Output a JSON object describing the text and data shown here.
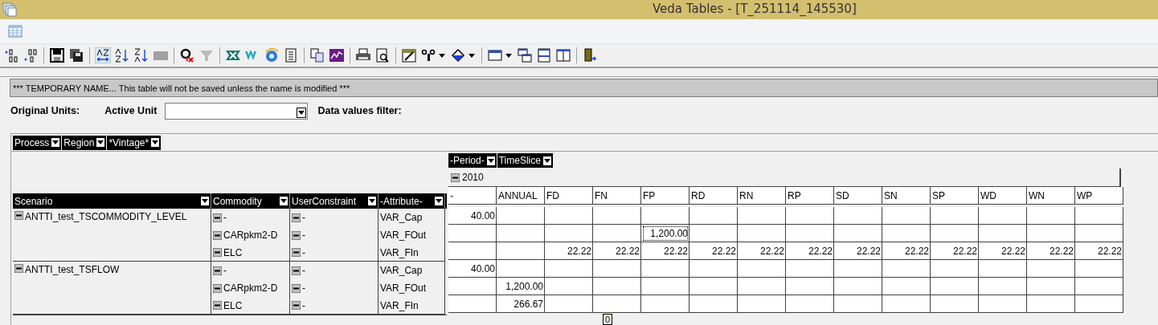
{
  "window": {
    "title": "Veda Tables - [T_251114_145530]"
  },
  "banner": "*** TEMPORARY NAME... This table will not be saved unless the name is modified ***",
  "filters": {
    "original_units": "Original Units:",
    "active_unit": "Active Unit",
    "data_values_filter": "Data values filter:"
  },
  "page_fields": [
    "Process",
    "Region",
    "*Vintage*"
  ],
  "column_fields": [
    "-Period-",
    "TimeSlice"
  ],
  "period": "2010",
  "row_headers": [
    "Scenario",
    "Commodity",
    "UserConstraint",
    "-Attribute-"
  ],
  "columns": [
    "-",
    "ANNUAL",
    "FD",
    "FN",
    "FP",
    "RD",
    "RN",
    "RP",
    "SD",
    "SN",
    "SP",
    "WD",
    "WN",
    "WP"
  ],
  "groups": [
    {
      "scenario": "ANTTI_test_TSCOMMODITY_LEVEL",
      "rows": [
        {
          "commodity": "-",
          "user_constraint": "-",
          "attribute": "VAR_Cap",
          "cells": [
            {
              "value": "40.00",
              "selected": false
            },
            null,
            null,
            null,
            null,
            null,
            null,
            null,
            null,
            null,
            null,
            null,
            null,
            null
          ]
        },
        {
          "commodity": "CARpkm2-D",
          "user_constraint": "-",
          "attribute": "VAR_FOut",
          "cells": [
            null,
            null,
            null,
            null,
            {
              "value": "1,200.00",
              "selected": true
            },
            null,
            null,
            null,
            null,
            null,
            null,
            null,
            null,
            null
          ]
        },
        {
          "commodity": "ELC",
          "user_constraint": "-",
          "attribute": "VAR_FIn",
          "cells": [
            null,
            null,
            {
              "value": "22.22",
              "selected": false
            },
            {
              "value": "22.22",
              "selected": false
            },
            {
              "value": "22.22",
              "selected": false
            },
            {
              "value": "22.22",
              "selected": false
            },
            {
              "value": "22.22",
              "selected": false
            },
            {
              "value": "22.22",
              "selected": false
            },
            {
              "value": "22.22",
              "selected": false
            },
            {
              "value": "22.22",
              "selected": false
            },
            {
              "value": "22.22",
              "selected": false
            },
            {
              "value": "22.22",
              "selected": false
            },
            {
              "value": "22.22",
              "selected": false
            },
            {
              "value": "22.22",
              "selected": false
            }
          ]
        }
      ]
    },
    {
      "scenario": "ANTTI_test_TSFLOW",
      "rows": [
        {
          "commodity": "-",
          "user_constraint": "-",
          "attribute": "VAR_Cap",
          "cells": [
            {
              "value": "40.00",
              "selected": false
            },
            null,
            null,
            null,
            null,
            null,
            null,
            null,
            null,
            null,
            null,
            null,
            null,
            null
          ]
        },
        {
          "commodity": "CARpkm2-D",
          "user_constraint": "-",
          "attribute": "VAR_FOut",
          "cells": [
            null,
            {
              "value": "1,200.00",
              "selected": false
            },
            null,
            null,
            null,
            null,
            null,
            null,
            null,
            null,
            null,
            null,
            null,
            null
          ]
        },
        {
          "commodity": "ELC",
          "user_constraint": "-",
          "attribute": "VAR_FIn",
          "cells": [
            null,
            {
              "value": "266.67",
              "selected": false
            },
            null,
            null,
            null,
            null,
            null,
            null,
            null,
            null,
            null,
            null,
            null,
            null
          ]
        }
      ]
    }
  ],
  "tooltip": "0"
}
